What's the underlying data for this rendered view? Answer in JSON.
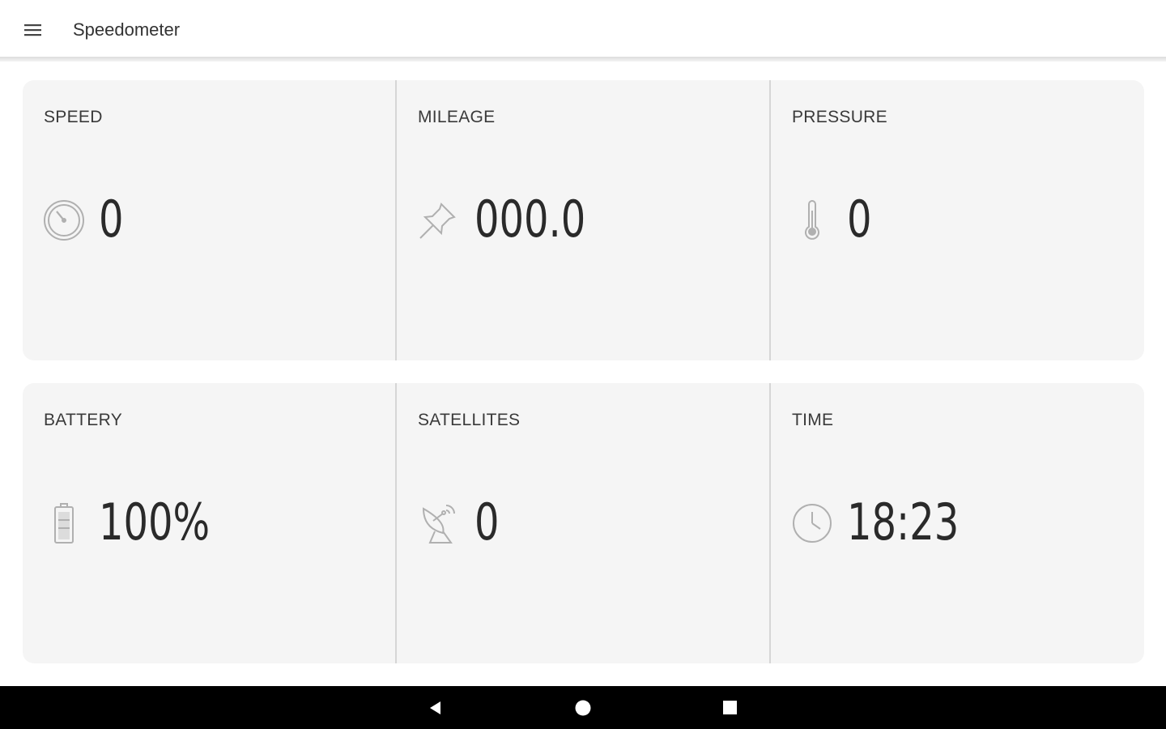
{
  "app": {
    "title": "Speedometer",
    "menu_icon": "hamburger-menu-icon"
  },
  "tiles": [
    {
      "label": "SPEED",
      "value": "0",
      "icon": "speedometer-gauge-icon"
    },
    {
      "label": "MILEAGE",
      "value": "000.0",
      "icon": "pushpin-icon"
    },
    {
      "label": "PRESSURE",
      "value": "0",
      "icon": "thermometer-icon"
    },
    {
      "label": "BATTERY",
      "value": "100%",
      "icon": "battery-icon"
    },
    {
      "label": "SATELLITES",
      "value": "0",
      "icon": "satellite-dish-icon"
    },
    {
      "label": "TIME",
      "value": "18:23",
      "icon": "clock-icon"
    }
  ],
  "navbar": {
    "buttons": [
      "back-icon",
      "home-icon",
      "recents-icon"
    ]
  },
  "colors": {
    "card_bg": "#f5f5f5",
    "icon_stroke": "#b0b0b0",
    "navbar_bg": "#000000"
  }
}
